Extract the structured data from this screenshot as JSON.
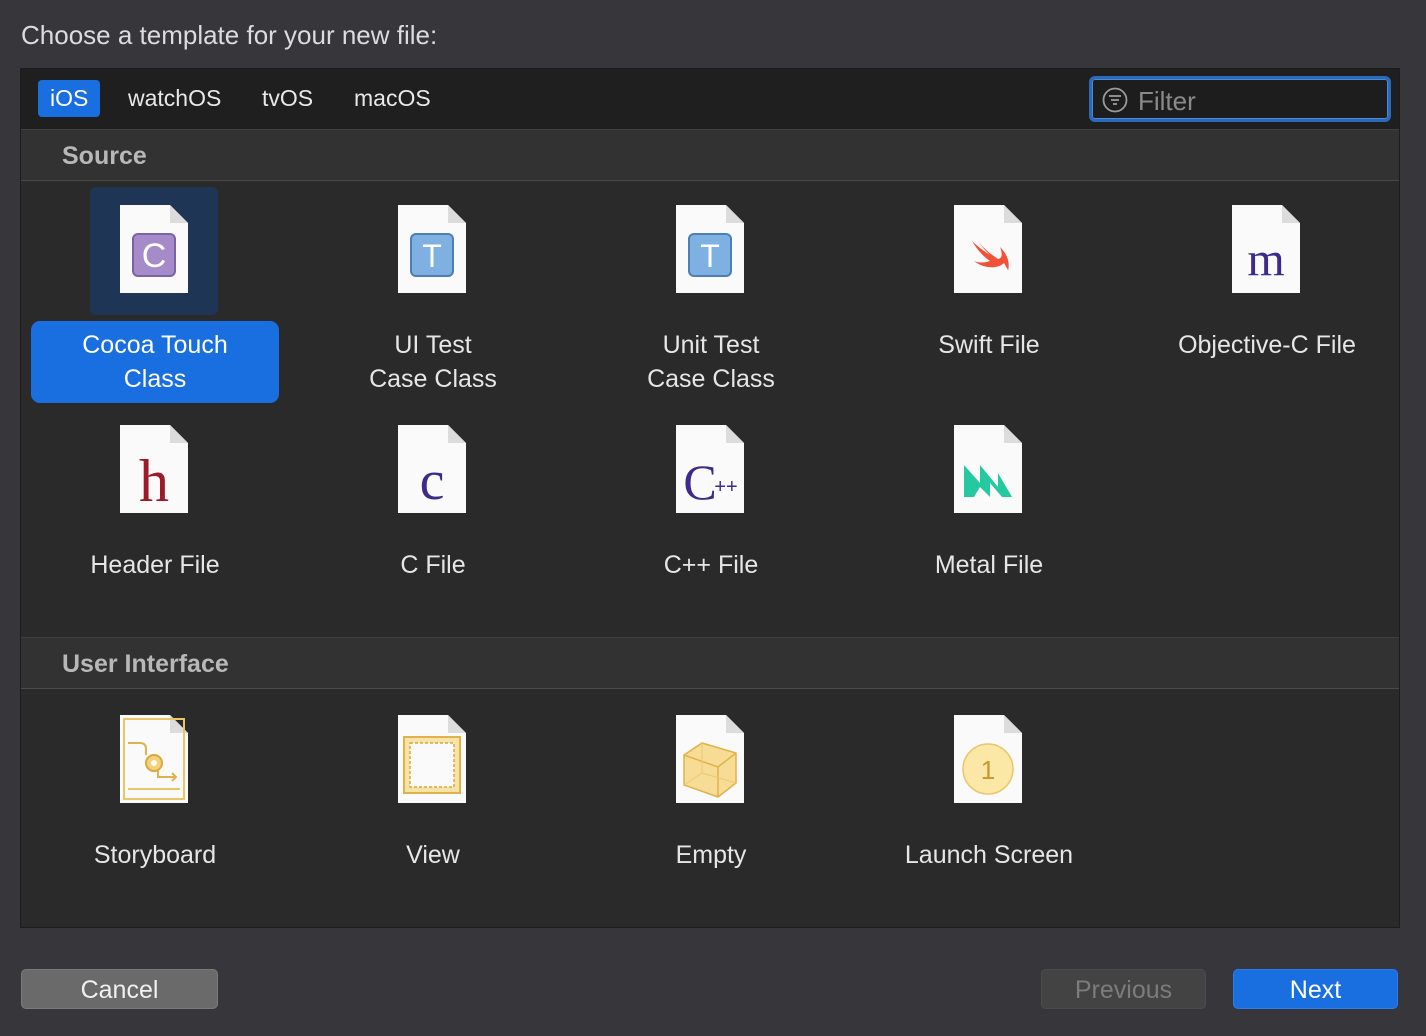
{
  "prompt": "Choose a template for your new file:",
  "tabs": [
    {
      "label": "iOS",
      "active": true
    },
    {
      "label": "watchOS",
      "active": false
    },
    {
      "label": "tvOS",
      "active": false
    },
    {
      "label": "macOS",
      "active": false
    }
  ],
  "filter": {
    "placeholder": "Filter",
    "icon": "filter-icon"
  },
  "sections": [
    {
      "title": "Source",
      "items": [
        {
          "label": "Cocoa Touch\nClass",
          "icon": "cocoa-touch-class-icon",
          "selected": true
        },
        {
          "label": "UI Test\nCase Class",
          "icon": "ui-test-case-icon"
        },
        {
          "label": "Unit Test\nCase Class",
          "icon": "unit-test-case-icon"
        },
        {
          "label": "Swift File",
          "icon": "swift-file-icon"
        },
        {
          "label": "Objective-C File",
          "icon": "objective-c-file-icon"
        },
        {
          "label": "Header File",
          "icon": "header-file-icon"
        },
        {
          "label": "C File",
          "icon": "c-file-icon"
        },
        {
          "label": "C++ File",
          "icon": "cpp-file-icon"
        },
        {
          "label": "Metal File",
          "icon": "metal-file-icon"
        }
      ]
    },
    {
      "title": "User Interface",
      "items": [
        {
          "label": "Storyboard",
          "icon": "storyboard-icon"
        },
        {
          "label": "View",
          "icon": "view-icon"
        },
        {
          "label": "Empty",
          "icon": "empty-icon"
        },
        {
          "label": "Launch Screen",
          "icon": "launch-screen-icon"
        }
      ]
    }
  ],
  "buttons": {
    "cancel": "Cancel",
    "previous": "Previous",
    "next": "Next"
  },
  "colors": {
    "accent": "#1a6fe0",
    "selection_bg": "#1e3556"
  }
}
